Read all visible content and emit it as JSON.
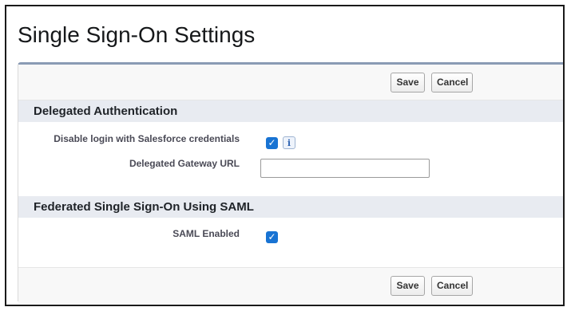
{
  "page": {
    "title": "Single Sign-On Settings"
  },
  "buttons": {
    "save_label": "Save",
    "cancel_label": "Cancel"
  },
  "sections": {
    "delegated": {
      "title": "Delegated Authentication",
      "disable_login_label": "Disable login with Salesforce credentials",
      "disable_login_checked": true,
      "info_glyph": "i",
      "gateway_label": "Delegated Gateway URL",
      "gateway_value": ""
    },
    "saml": {
      "title": "Federated Single Sign-On Using SAML",
      "enabled_label": "SAML Enabled",
      "enabled_checked": true
    }
  },
  "colors": {
    "checkbox": "#1873d3",
    "section_bg": "#e8ebf1",
    "panel_accent": "#8a9bb4"
  },
  "icons": {
    "checkmark": "✓",
    "info": "info-icon"
  }
}
